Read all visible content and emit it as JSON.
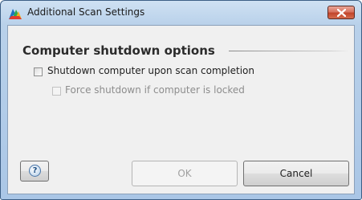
{
  "window": {
    "title": "Additional Scan Settings",
    "close_icon": "close-icon",
    "app_icon": "avg-logo-icon"
  },
  "section": {
    "title": "Computer shutdown options"
  },
  "options": [
    {
      "label": "Shutdown computer upon scan completion",
      "checked": false,
      "enabled": true
    },
    {
      "label": "Force shutdown if computer is locked",
      "checked": false,
      "enabled": false
    }
  ],
  "buttons": {
    "help_icon": "help-icon",
    "help_glyph": "?",
    "ok_label": "OK",
    "ok_enabled": false,
    "cancel_label": "Cancel"
  }
}
